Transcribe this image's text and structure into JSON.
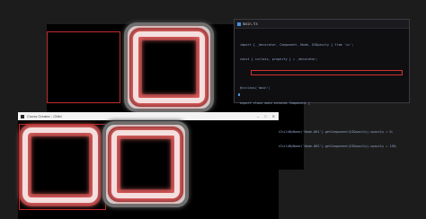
{
  "editor": {
    "tab_label": "main.ts",
    "code_lines": [
      "import { _decorator, Component, Node, UIOpacity } from 'cc';",
      "const { ccclass, property } = _decorator;",
      "",
      "@ccclass('main')",
      "export class main extends Component {",
      "    start() {",
      "        this.node.getChildByName('Node-001').getComponent(UIOpacity).opacity = 0;",
      "        this.node.getChildByName('Node-002').getComponent(UIOpacity).opacity = 150;",
      "    }",
      "}"
    ]
  },
  "preview_window": {
    "title": "Cocos Creator - Chibi",
    "controls": [
      "–",
      "□",
      "✕"
    ]
  },
  "colors": {
    "selection_red": "#c22b2b",
    "glow_red": "#e06060",
    "editor_bg": "#0f0f12",
    "app_bg": "#1c1c1c"
  }
}
